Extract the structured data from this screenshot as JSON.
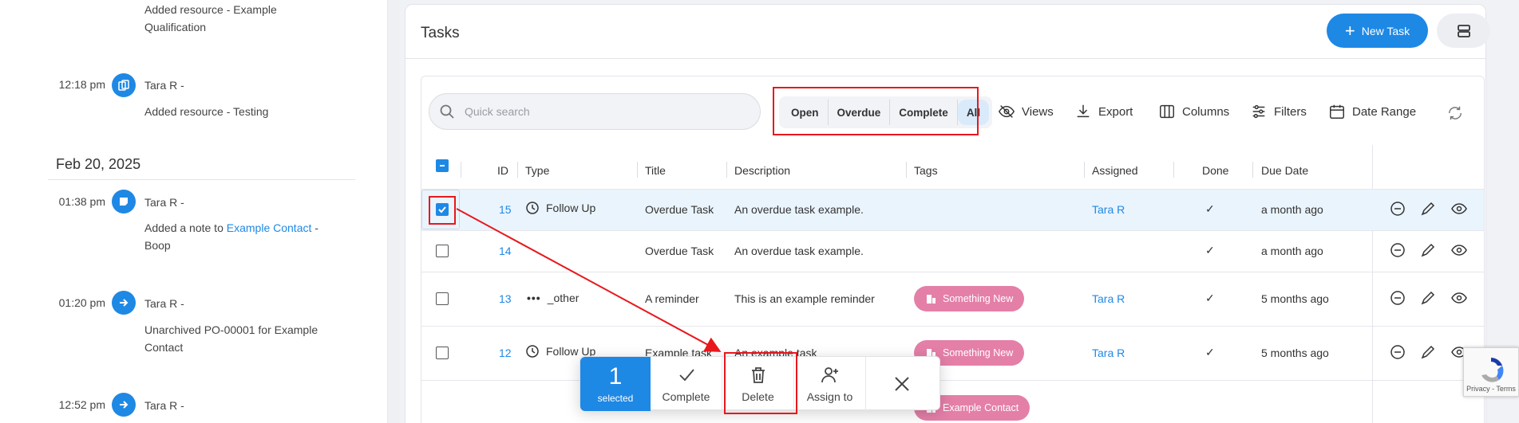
{
  "activity": {
    "items": [
      {
        "time": "",
        "name": "",
        "lines": [
          "Added resource - Example",
          "Qualification"
        ]
      },
      {
        "time": "12:18 pm",
        "name": "Tara R -",
        "text": "Added resource - Testing"
      },
      {
        "time": "01:38 pm",
        "name": "Tara R -",
        "text_prefix": "Added a note to ",
        "link": "Example Contact",
        "text_suffix": " -",
        "line2": "Boop"
      },
      {
        "time": "01:20 pm",
        "name": "Tara R -",
        "lines": [
          "Unarchived PO-00001 for Example",
          "Contact"
        ]
      },
      {
        "time": "12:52 pm",
        "name": "Tara R -"
      }
    ],
    "date_heading": "Feb 20, 2025"
  },
  "tasks": {
    "title": "Tasks",
    "new_task_label": "New Task",
    "search_placeholder": "Quick search",
    "segments": [
      "Open",
      "Overdue",
      "Complete",
      "All"
    ],
    "active_segment": "All",
    "tools": {
      "views": "Views",
      "export": "Export",
      "columns": "Columns",
      "filters": "Filters",
      "date_range": "Date Range"
    },
    "columns": [
      "ID",
      "Type",
      "Title",
      "Description",
      "Tags",
      "Assigned",
      "Done",
      "Due Date"
    ],
    "rows": [
      {
        "id": "15",
        "type": "Follow Up",
        "title": "Overdue Task",
        "description": "An overdue task example.",
        "tag": "",
        "assigned": "Tara R",
        "done": "✓",
        "due": "a month ago",
        "selected": true
      },
      {
        "id": "14",
        "type": "",
        "title": "Overdue Task",
        "description": "An overdue task example.",
        "tag": "",
        "assigned": "",
        "done": "✓",
        "due": "a month ago",
        "selected": false
      },
      {
        "id": "13",
        "type": "_other",
        "title": "A reminder",
        "description": "This is an example reminder",
        "tag": "Something New",
        "assigned": "Tara R",
        "done": "✓",
        "due": "5 months ago",
        "selected": false
      },
      {
        "id": "12",
        "type": "Follow Up",
        "title": "Example task",
        "description": "An example task",
        "tag": "Something New",
        "assigned": "Tara R",
        "done": "✓",
        "due": "5 months ago",
        "selected": false
      },
      {
        "tag": "Example Contact"
      }
    ]
  },
  "bulk_bar": {
    "count": "1",
    "count_label": "selected",
    "complete": "Complete",
    "delete": "Delete",
    "assign": "Assign to"
  },
  "recaptcha": {
    "text": "Privacy - Terms"
  },
  "colors": {
    "accent": "#1e88e5",
    "tag": "#e47fa8",
    "highlight": "#e8181d",
    "selected_row": "#eaf4fd"
  }
}
